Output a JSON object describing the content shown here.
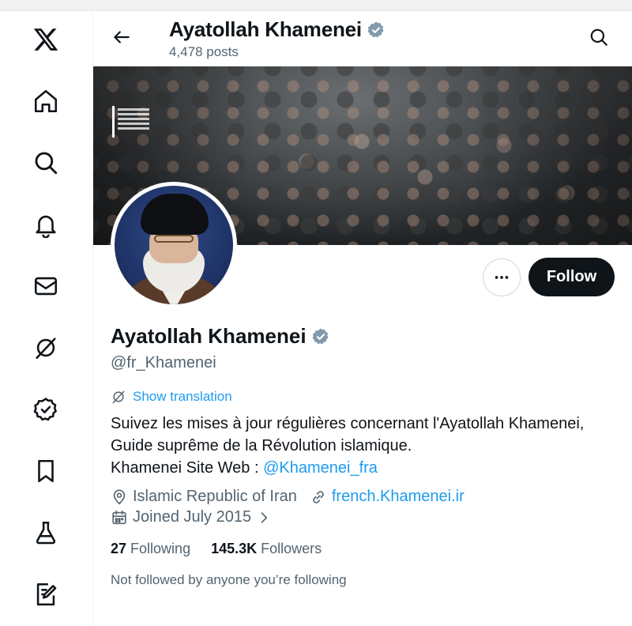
{
  "nav": {
    "items": [
      {
        "icon": "x-logo-icon"
      },
      {
        "icon": "home-icon"
      },
      {
        "icon": "search-icon"
      },
      {
        "icon": "bell-icon"
      },
      {
        "icon": "mail-icon"
      },
      {
        "icon": "grok-icon"
      },
      {
        "icon": "verified-icon"
      },
      {
        "icon": "bookmark-icon"
      },
      {
        "icon": "flask-icon"
      },
      {
        "icon": "compose-icon"
      }
    ]
  },
  "header": {
    "name": "Ayatollah Khamenei",
    "posts": "4,478 posts"
  },
  "profile": {
    "name": "Ayatollah Khamenei",
    "handle": "@fr_Khamenei",
    "follow_label": "Follow",
    "show_translation": "Show translation",
    "bio_line1": "Suivez les mises à jour régulières concernant l'Ayatollah Khamenei,",
    "bio_line2": "Guide suprême de la Révolution islamique.",
    "bio_line3_prefix": "Khamenei Site Web : ",
    "bio_link": "@Khamenei_fra",
    "location": "Islamic Republic of Iran",
    "website": "french.Khamenei.ir",
    "joined": "Joined July 2015",
    "following_count": "27",
    "following_label": "Following",
    "followers_count": "145.3K",
    "followers_label": "Followers",
    "not_followed": "Not followed by anyone you’re following"
  },
  "colors": {
    "link": "#1d9bf0",
    "text": "#0f1419",
    "secondary": "#536471",
    "verified_badge": "#829aab"
  }
}
